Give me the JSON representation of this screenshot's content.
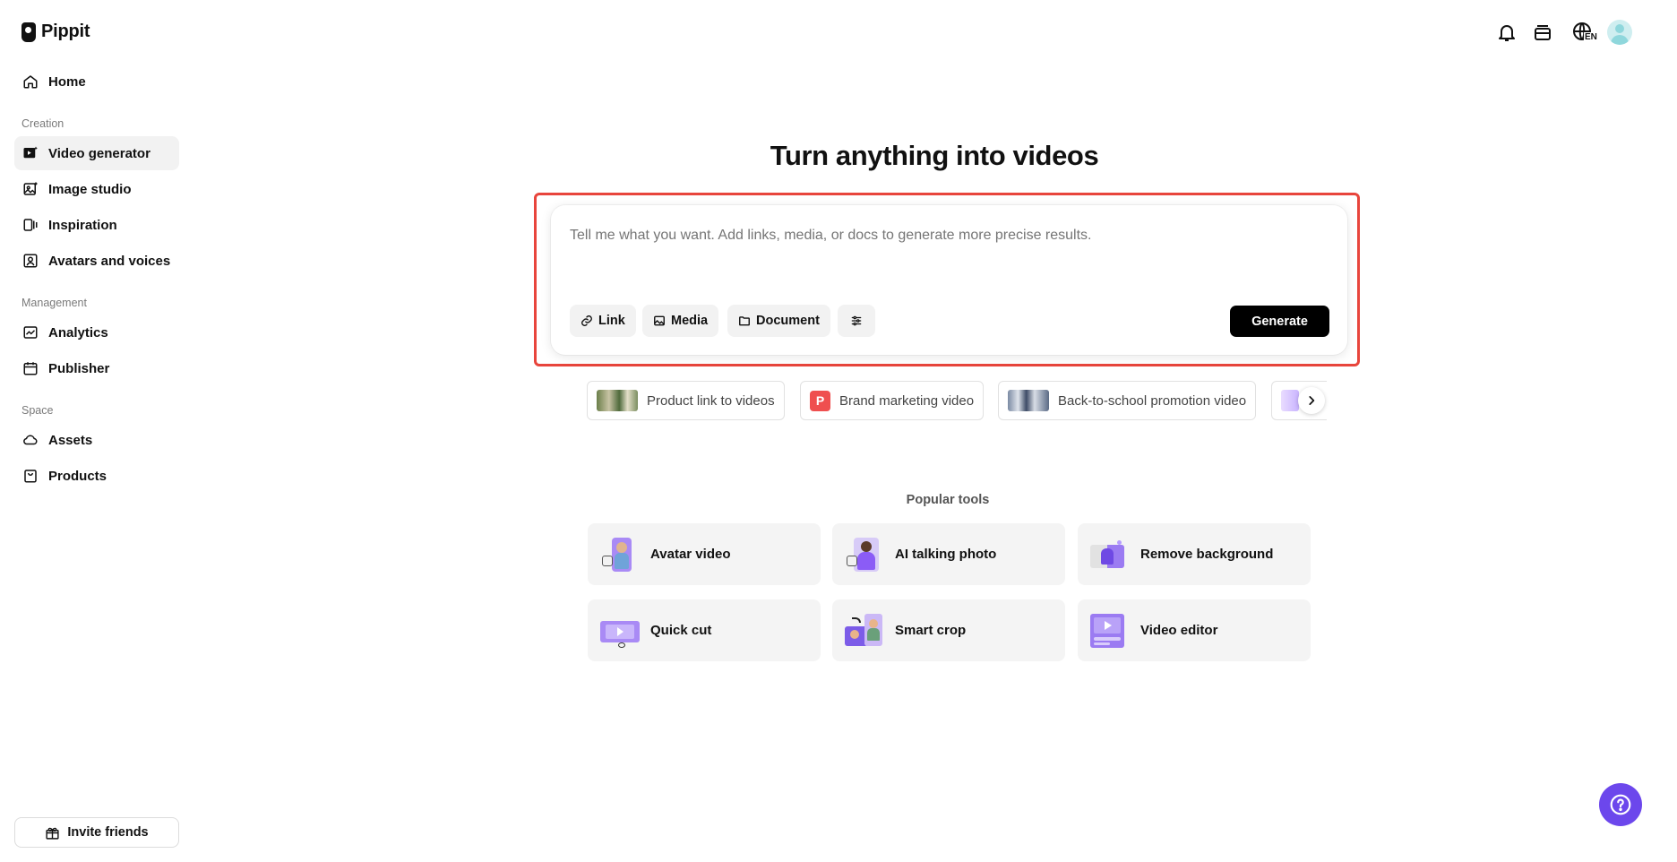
{
  "app": {
    "name": "Pippit"
  },
  "sidebar": {
    "home": "Home",
    "sections": {
      "creation": "Creation",
      "management": "Management",
      "space": "Space"
    },
    "items": {
      "video_generator": "Video generator",
      "image_studio": "Image studio",
      "inspiration": "Inspiration",
      "avatars_voices": "Avatars and voices",
      "analytics": "Analytics",
      "publisher": "Publisher",
      "assets": "Assets",
      "products": "Products"
    },
    "active": "Video generator",
    "invite": "Invite friends"
  },
  "topbar": {
    "language": "EN",
    "icons": [
      "bell-icon",
      "credits-icon",
      "language-icon",
      "user-avatar"
    ]
  },
  "main": {
    "headline": "Turn anything into videos",
    "prompt": {
      "placeholder": "Tell me what you want. Add links, media, or docs to generate more precise results.",
      "value": ""
    },
    "chips": {
      "link": "Link",
      "media": "Media",
      "document": "Document"
    },
    "generate": "Generate",
    "suggestions": [
      "Product link to videos",
      "Brand marketing video",
      "Back-to-school promotion video"
    ],
    "popular_title": "Popular tools",
    "tools": [
      "Avatar video",
      "AI talking photo",
      "Remove background",
      "Quick cut",
      "Smart crop",
      "Video editor"
    ]
  },
  "colors": {
    "accent": "#6c47ec",
    "highlight": "#e8453c",
    "primary_button": "#000000"
  }
}
